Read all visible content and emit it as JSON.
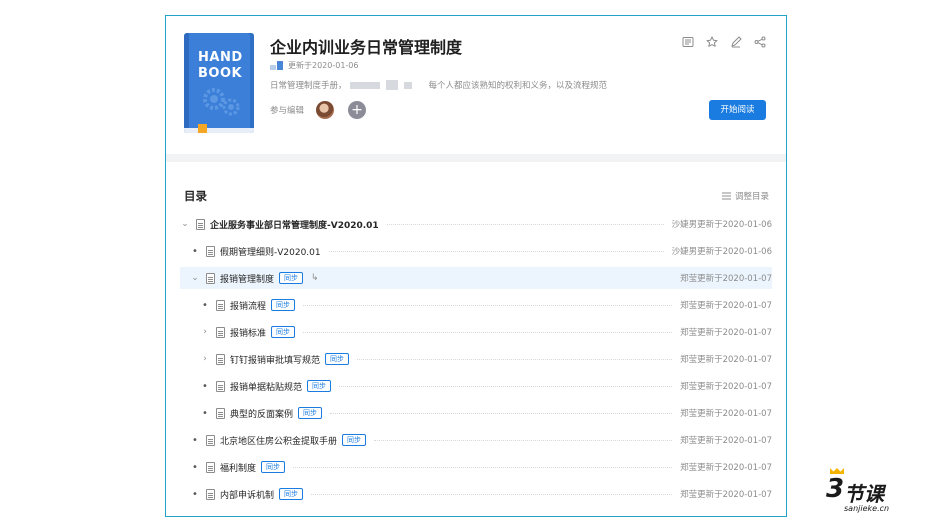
{
  "header": {
    "title": "企业内训业务日常管理制度",
    "updated": "更新于2020-01-06",
    "description_prefix": "日常管理制度手册，",
    "description_suffix": "每个人都应该熟知的权利和义务，以及流程规范",
    "editors_label": "参与编辑",
    "add_icon": "+",
    "start_button": "开始阅读",
    "book_cover": {
      "line1": "HAND",
      "line2": "BOOK"
    },
    "icons": [
      "list-icon",
      "star-icon",
      "edit-icon",
      "share-icon"
    ]
  },
  "toc": {
    "title": "目录",
    "adjust_label": "调整目录",
    "sync_label": "同步",
    "items": [
      {
        "label": "企业服务事业部日常管理制度-V2020.01",
        "updated": "沙婕男更新于2020-01-06"
      },
      {
        "label": "假期管理细则-V2020.01",
        "updated": "沙婕男更新于2020-01-06"
      },
      {
        "label": "报销管理制度",
        "updated": "郑莹更新于2020-01-07"
      },
      {
        "label": "报销流程",
        "updated": "郑莹更新于2020-01-07"
      },
      {
        "label": "报销标准",
        "updated": "郑莹更新于2020-01-07"
      },
      {
        "label": "钉钉报销审批填写规范",
        "updated": "郑莹更新于2020-01-07"
      },
      {
        "label": "报销单据粘贴规范",
        "updated": "郑莹更新于2020-01-07"
      },
      {
        "label": "典型的反面案例",
        "updated": "郑莹更新于2020-01-07"
      },
      {
        "label": "北京地区住房公积金提取手册",
        "updated": "郑莹更新于2020-01-07"
      },
      {
        "label": "福利制度",
        "updated": "郑莹更新于2020-01-07"
      },
      {
        "label": "内部申诉机制",
        "updated": "郑莹更新于2020-01-07"
      }
    ]
  },
  "watermark": {
    "num": "3",
    "text": "节课",
    "site": "sanjieke.cn"
  },
  "colors": {
    "accent": "#1a7ce0",
    "frame": "#22a3c7",
    "book": "#3b7fd8",
    "ribbon": "#f5a623"
  }
}
